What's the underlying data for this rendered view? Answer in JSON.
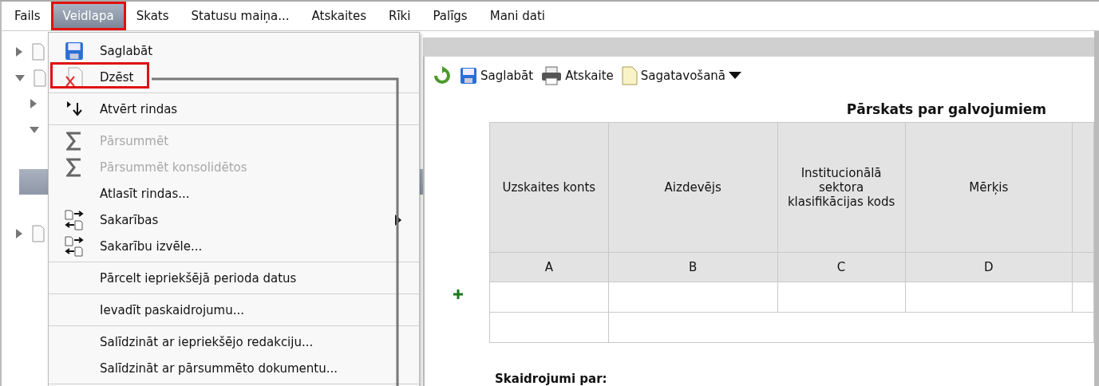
{
  "menubar": [
    {
      "label": "Fails",
      "selected": false,
      "highlighted": false
    },
    {
      "label": "Veidlapa",
      "selected": true,
      "highlighted": true
    },
    {
      "label": "Skats",
      "selected": false,
      "highlighted": false
    },
    {
      "label": "Statusu maiņa...",
      "selected": false,
      "highlighted": false
    },
    {
      "label": "Atskaites",
      "selected": false,
      "highlighted": false
    },
    {
      "label": "Rīki",
      "selected": false,
      "highlighted": false
    },
    {
      "label": "Palīgs",
      "selected": false,
      "highlighted": false
    },
    {
      "label": "Mani dati",
      "selected": false,
      "highlighted": false
    }
  ],
  "tree": [
    {
      "expanded": false
    },
    {
      "expanded": true,
      "children": [
        {
          "expanded": false
        },
        {
          "expanded": true,
          "children": [
            {
              "selected": false
            },
            {
              "selected": true
            },
            {
              "selected": false
            }
          ]
        }
      ]
    },
    {
      "expanded": false
    }
  ],
  "menu": {
    "items": [
      {
        "kind": "save",
        "label": "Saglabāt",
        "disabled": false,
        "highlighted": false,
        "submenu": false
      },
      {
        "kind": "delete",
        "label": "Dzēst",
        "disabled": false,
        "highlighted": true,
        "submenu": false
      },
      {
        "kind": "separator"
      },
      {
        "kind": "expand",
        "label": "Atvērt rindas",
        "disabled": false,
        "highlighted": false,
        "submenu": false
      },
      {
        "kind": "separator"
      },
      {
        "kind": "sigma",
        "label": "Pārsummēt",
        "disabled": true,
        "highlighted": false,
        "submenu": false
      },
      {
        "kind": "sigma",
        "label": "Pārsummēt konsolidētos",
        "disabled": true,
        "highlighted": false,
        "submenu": false
      },
      {
        "kind": "plain",
        "label": "Atlasīt rindas...",
        "disabled": false,
        "highlighted": false,
        "submenu": false
      },
      {
        "kind": "links",
        "label": "Sakarības",
        "disabled": false,
        "highlighted": false,
        "submenu": true
      },
      {
        "kind": "links",
        "label": "Sakarību izvēle...",
        "disabled": false,
        "highlighted": false,
        "submenu": false
      },
      {
        "kind": "separator"
      },
      {
        "kind": "plain",
        "label": "Pārcelt iepriekšējā perioda datus",
        "disabled": false,
        "highlighted": false,
        "submenu": false
      },
      {
        "kind": "separator"
      },
      {
        "kind": "plain",
        "label": "Ievadīt paskaidrojumu...",
        "disabled": false,
        "highlighted": false,
        "submenu": false
      },
      {
        "kind": "separator"
      },
      {
        "kind": "plain",
        "label": "Salīdzināt ar iepriekšējo redakciju...",
        "disabled": false,
        "highlighted": false,
        "submenu": false
      },
      {
        "kind": "plain",
        "label": "Salīdzināt ar pārsummēto dokumentu...",
        "disabled": false,
        "highlighted": false,
        "submenu": false
      },
      {
        "kind": "separator"
      }
    ]
  },
  "toolbar": [
    {
      "kind": "refresh"
    },
    {
      "kind": "save",
      "label": "Saglabāt"
    },
    {
      "kind": "printer",
      "label": "Atskaite"
    },
    {
      "kind": "document",
      "label": "Sagatavošanā",
      "dropdown": true
    }
  ],
  "report": {
    "title": "Pārskats par galvojumiem",
    "columns": [
      {
        "heading": "Uzskaites konts",
        "letter": "A"
      },
      {
        "heading": "Aizdevējs",
        "letter": "B"
      },
      {
        "heading": "Institucionālā sektora klasifikācijas kods",
        "letter": "C"
      },
      {
        "heading": "Mērķis",
        "letter": "D"
      }
    ],
    "section_heading": "Skaidrojumi par:"
  }
}
